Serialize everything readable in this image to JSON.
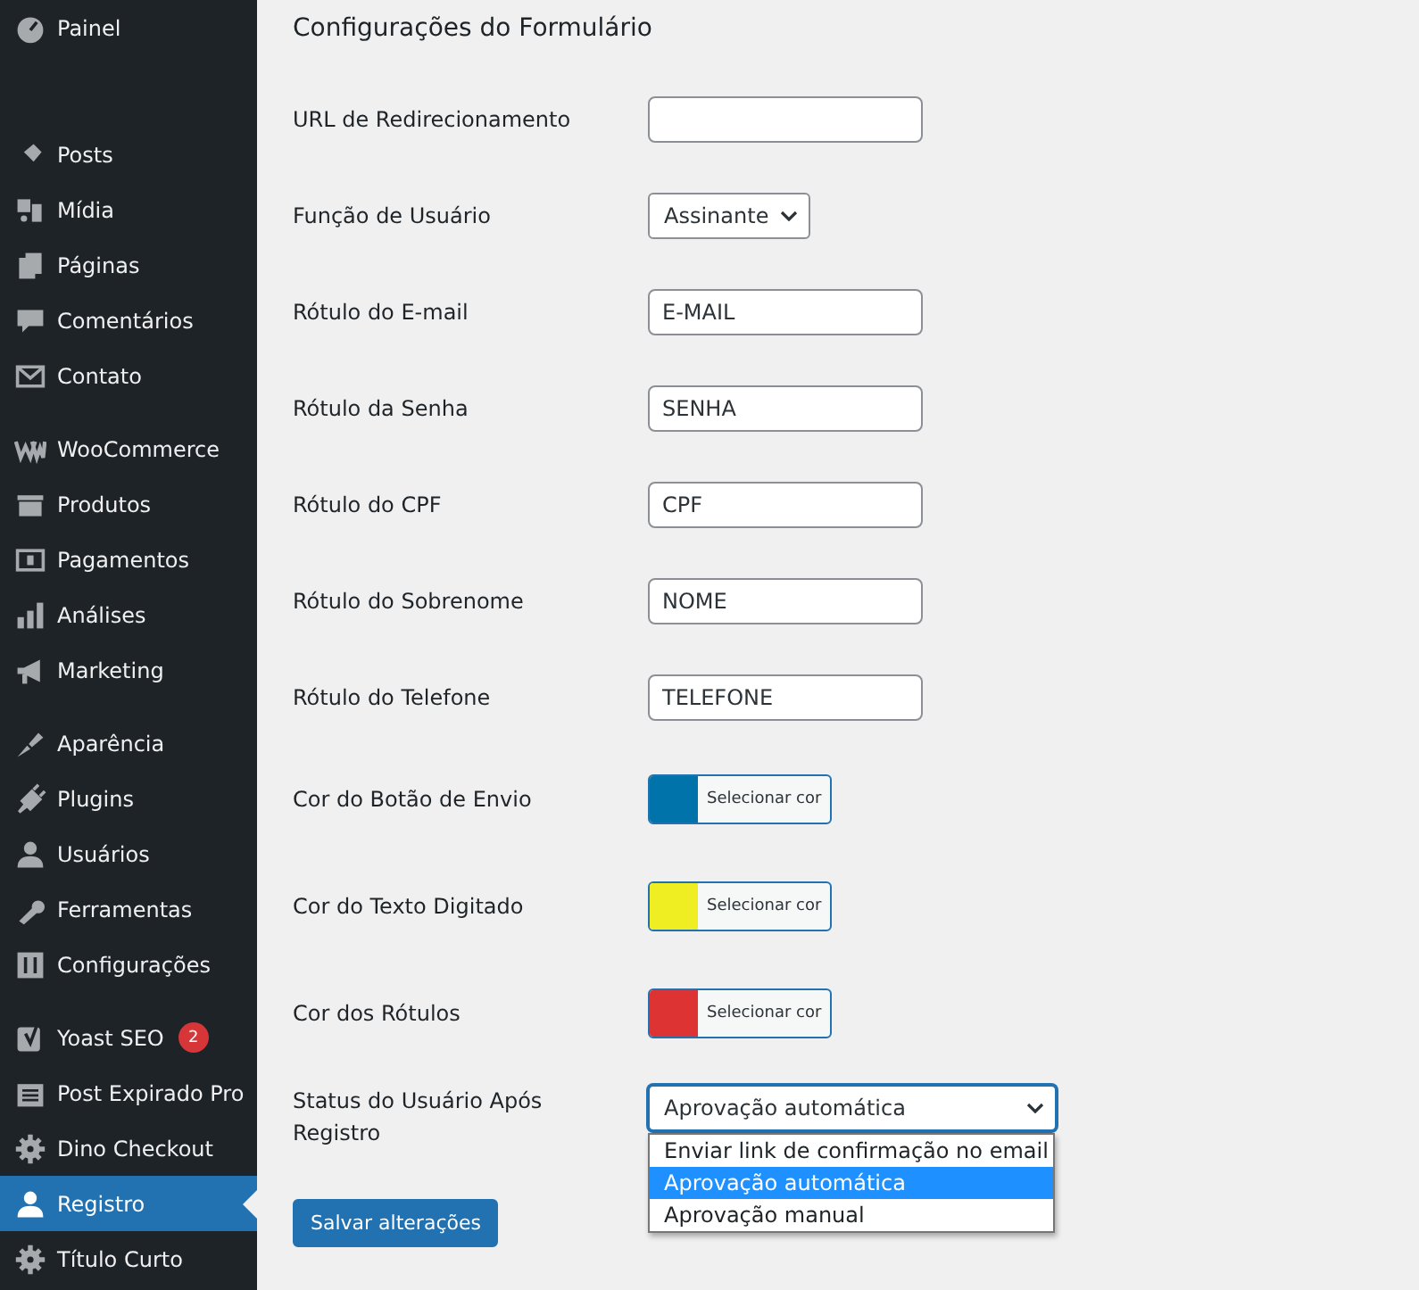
{
  "sidebar": {
    "groups": [
      [
        {
          "label": "Painel",
          "selected": false
        }
      ],
      [
        {
          "label": "Posts",
          "selected": false
        },
        {
          "label": "Mídia",
          "selected": false
        },
        {
          "label": "Páginas",
          "selected": false
        },
        {
          "label": "Comentários",
          "selected": false
        },
        {
          "label": "Contato",
          "selected": false
        }
      ],
      [
        {
          "label": "WooCommerce",
          "selected": false
        },
        {
          "label": "Produtos",
          "selected": false
        },
        {
          "label": "Pagamentos",
          "selected": false
        },
        {
          "label": "Análises",
          "selected": false
        },
        {
          "label": "Marketing",
          "selected": false
        }
      ],
      [
        {
          "label": "Aparência",
          "selected": false
        },
        {
          "label": "Plugins",
          "selected": false
        },
        {
          "label": "Usuários",
          "selected": false
        },
        {
          "label": "Ferramentas",
          "selected": false
        },
        {
          "label": "Configurações",
          "selected": false
        }
      ],
      [
        {
          "label": "Yoast SEO",
          "selected": false,
          "badge": "2"
        },
        {
          "label": "Post Expirado Pro",
          "selected": false
        },
        {
          "label": "Dino Checkout",
          "selected": false
        },
        {
          "label": "Registro",
          "selected": true
        },
        {
          "label": "Título Curto",
          "selected": false
        }
      ]
    ]
  },
  "form": {
    "title": "Configurações do Formulário",
    "rows": [
      {
        "kind": "text",
        "label": "URL de Redirecionamento"
      },
      {
        "kind": "select",
        "label": "Função de Usuário",
        "value": "Assinante"
      },
      {
        "kind": "text",
        "label": "Rótulo do E-mail",
        "value": "E-MAIL"
      },
      {
        "kind": "text",
        "label": "Rótulo da Senha",
        "value": "SENHA"
      },
      {
        "kind": "text",
        "label": "Rótulo do CPF",
        "value": "CPF"
      },
      {
        "kind": "text",
        "label": "Rótulo do Sobrenome",
        "value": "NOME"
      },
      {
        "kind": "text",
        "label": "Rótulo do Telefone",
        "value": "TELEFONE"
      },
      {
        "kind": "color",
        "label": "Cor do Botão de Envio",
        "color": "#0073aa",
        "button": "Selecionar cor"
      },
      {
        "kind": "color",
        "label": "Cor do Texto Digitado",
        "color": "#eeee22",
        "button": "Selecionar cor"
      },
      {
        "kind": "color",
        "label": "Cor dos Rótulos",
        "color": "#dd3333",
        "button": "Selecionar cor"
      },
      {
        "kind": "dropdown",
        "label": "Status do Usuário Após Registro",
        "value": "Aprovação automática",
        "expanded": true,
        "options": [
          {
            "label": "Enviar link de confirmação no email",
            "selected": false
          },
          {
            "label": "Aprovação automática",
            "selected": true
          },
          {
            "label": "Aprovação manual",
            "selected": false
          }
        ]
      }
    ],
    "save_button": "Salvar alterações"
  }
}
